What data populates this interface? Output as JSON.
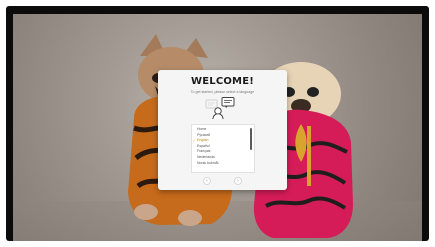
{
  "dialog": {
    "title": "WELCOME!",
    "subtitle": "To get started, please select a language",
    "languages": [
      "Home",
      "Русский",
      "English",
      "Español",
      "Français",
      "Nederlands",
      "Norsk bokmål"
    ],
    "selected_language": "English",
    "prev_icon": "chevron-left-icon",
    "next_icon": "chevron-right-icon"
  },
  "colors": {
    "accent": "#f2a814",
    "dialog_bg": "#f5f5f5",
    "selected_text": "#b88918"
  }
}
